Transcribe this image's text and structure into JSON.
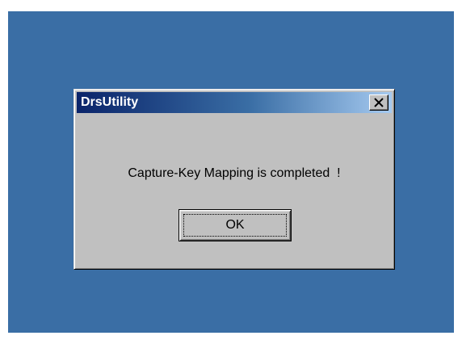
{
  "dialog": {
    "title": "DrsUtility",
    "message": "Capture-Key Mapping is completed  !",
    "ok_label": "OK",
    "close_icon": "close-icon"
  },
  "colors": {
    "desktop": "#3a6ea5",
    "titlebar_start": "#0a246a",
    "titlebar_end": "#a6caf0",
    "dialog_face": "#c0c0c0"
  }
}
